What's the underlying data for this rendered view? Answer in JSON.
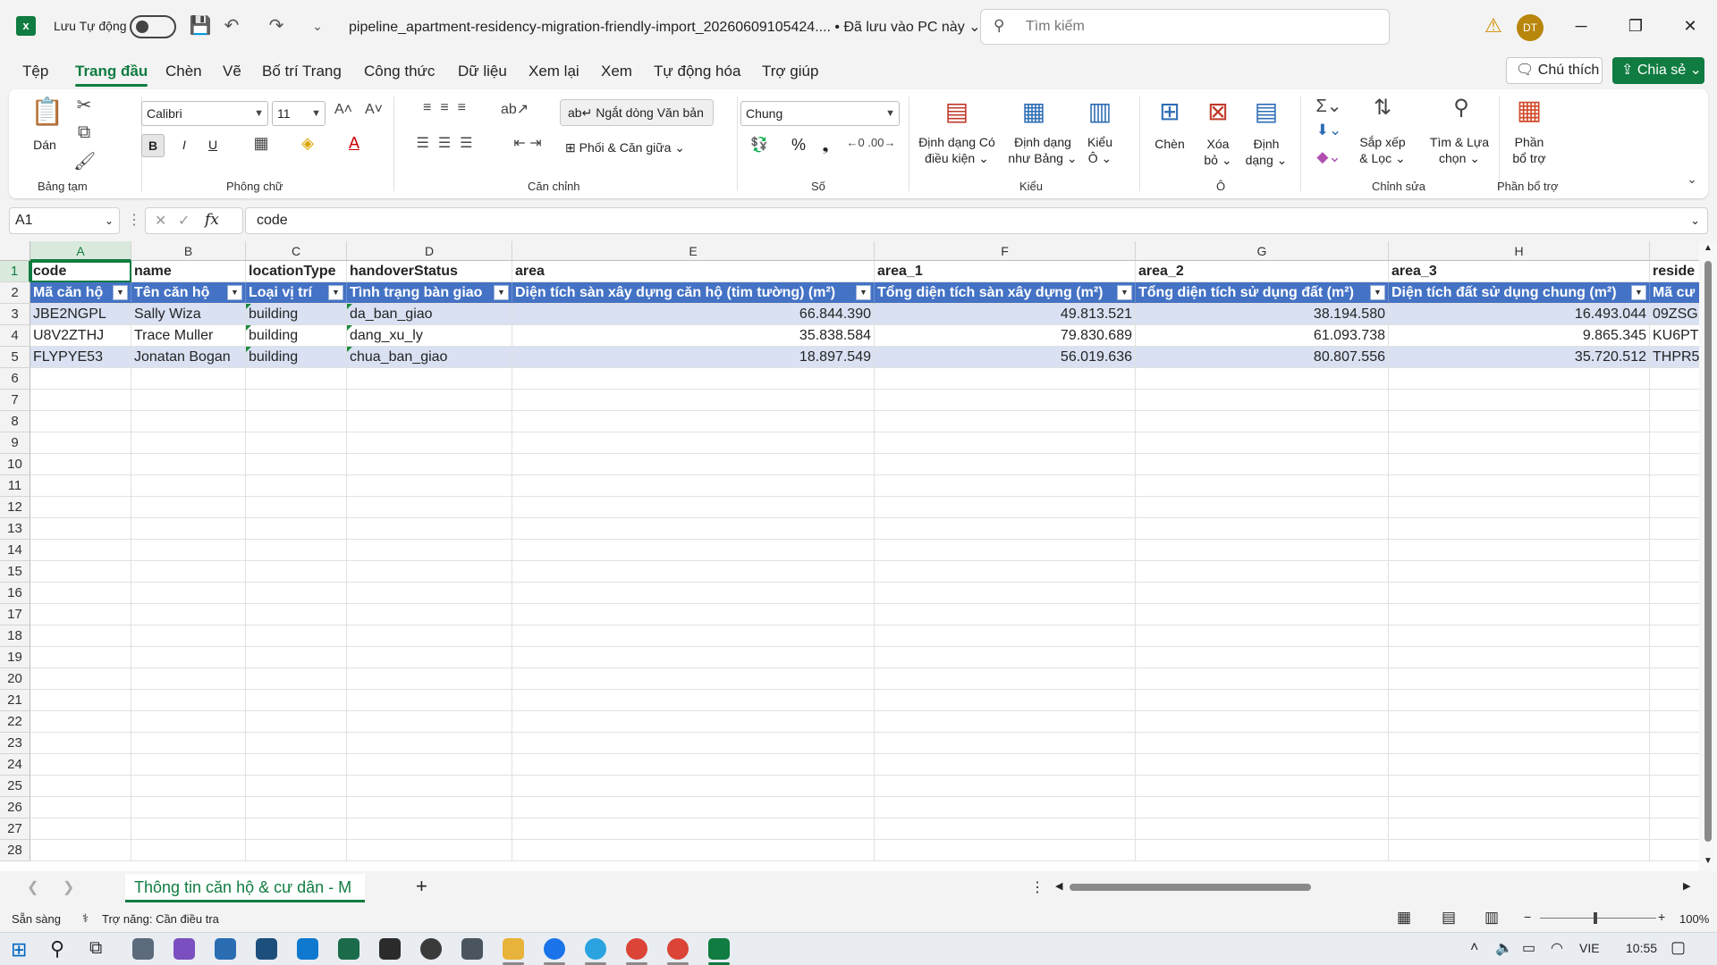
{
  "titlebar": {
    "app_icon": "excel-logo-icon",
    "app_letter": "x",
    "autosave_label": "Lưu Tự động",
    "file_title": "pipeline_apartment-residency-migration-friendly-import_20260609105424....  •  Đã lưu vào PC này ⌄",
    "search_placeholder": "Tìm kiếm",
    "avatar_initials": "DT",
    "minimize": "─",
    "maximize": "❐",
    "close": "✕"
  },
  "menu": {
    "tabs": [
      "Tệp",
      "Trang đầu",
      "Chèn",
      "Vẽ",
      "Bố trí Trang",
      "Công thức",
      "Dữ liệu",
      "Xem lại",
      "Xem",
      "Tự động hóa",
      "Trợ giúp"
    ],
    "active_index": 1,
    "comment_label": "Chú thích",
    "share_label": "Chia sẻ"
  },
  "ribbon": {
    "clipboard": {
      "paste": "Dán",
      "group": "Bảng tạm"
    },
    "font": {
      "name": "Calibri",
      "size": "11",
      "bold": "B",
      "italic": "I",
      "underline": "U",
      "group": "Phông chữ"
    },
    "alignment": {
      "wrap": "Ngắt dòng Văn bản",
      "merge": "Phối & Căn giữa",
      "group": "Căn chỉnh"
    },
    "number": {
      "format": "Chung",
      "percent": "%",
      "comma": "❟",
      "group": "Số"
    },
    "styles": {
      "conditional_1": "Định dạng Có",
      "conditional_2": "điều kiện ⌄",
      "table_1": "Định dạng",
      "table_2": "như Bảng ⌄",
      "cell_1": "Kiểu",
      "cell_2": "Ô ⌄",
      "group": "Kiểu"
    },
    "cells": {
      "insert": "Chèn",
      "delete_1": "Xóa",
      "delete_2": "bỏ ⌄",
      "format_1": "Định",
      "format_2": "dạng ⌄",
      "group": "Ô"
    },
    "editing": {
      "sort_1": "Sắp xếp",
      "sort_2": "& Lọc ⌄",
      "find_1": "Tìm & Lựa",
      "find_2": "chọn ⌄",
      "group": "Chỉnh sửa"
    },
    "addins": {
      "label_1": "Phần",
      "label_2": "bổ trợ",
      "group": "Phần bổ trợ"
    }
  },
  "formula_bar": {
    "name_box": "A1",
    "fx": "fx",
    "value": "code"
  },
  "columns": [
    "A",
    "B",
    "C",
    "D",
    "E",
    "F",
    "G",
    "H",
    ""
  ],
  "rows": [
    [
      "code",
      "name",
      "locationType",
      "handoverStatus",
      "area",
      "area_1",
      "area_2",
      "area_3",
      "reside"
    ],
    [
      "Mã căn hộ",
      "Tên căn hộ",
      "Loại vị trí",
      "Tình trạng bàn giao",
      "Diện tích sàn xây dựng căn hộ (tim tường) (m²)",
      "Tổng diện tích sàn xây dựng (m²)",
      "Tổng diện tích sử dụng đất (m²)",
      "Diện tích đất sử dụng chung (m²)",
      "Mã cư"
    ],
    [
      "JBE2NGPL",
      "Sally Wiza",
      "building",
      "da_ban_giao",
      "66.844.390",
      "49.813.521",
      "38.194.580",
      "16.493.044",
      "09ZSG"
    ],
    [
      "U8V2ZTHJ",
      "Trace Muller",
      "building",
      "dang_xu_ly",
      "35.838.584",
      "79.830.689",
      "61.093.738",
      "9.865.345",
      "KU6PT"
    ],
    [
      "FLYPYE53",
      "Jonatan Bogan",
      "building",
      "chua_ban_giao",
      "18.897.549",
      "56.019.636",
      "80.807.556",
      "35.720.512",
      "THPR5"
    ]
  ],
  "row_numbers": [
    "1",
    "2",
    "3",
    "4",
    "5",
    "6",
    "7",
    "8",
    "9",
    "10",
    "11",
    "12",
    "13",
    "14",
    "15",
    "16",
    "17",
    "18",
    "19",
    "20",
    "21",
    "22",
    "23",
    "24",
    "25",
    "26",
    "27",
    "28"
  ],
  "sheet": {
    "tab_name": "Thông tin căn hộ  & cư dân - M",
    "add_label": "+"
  },
  "status": {
    "ready": "Sẵn sàng",
    "accessibility": "Trợ năng: Cần điều tra",
    "zoom": "100%"
  },
  "taskbar": {
    "language": "VIE",
    "time": "10:55"
  },
  "colors": {
    "accent": "#107c41",
    "table_header": "#4472c4",
    "table_band": "#d9e1f2"
  }
}
